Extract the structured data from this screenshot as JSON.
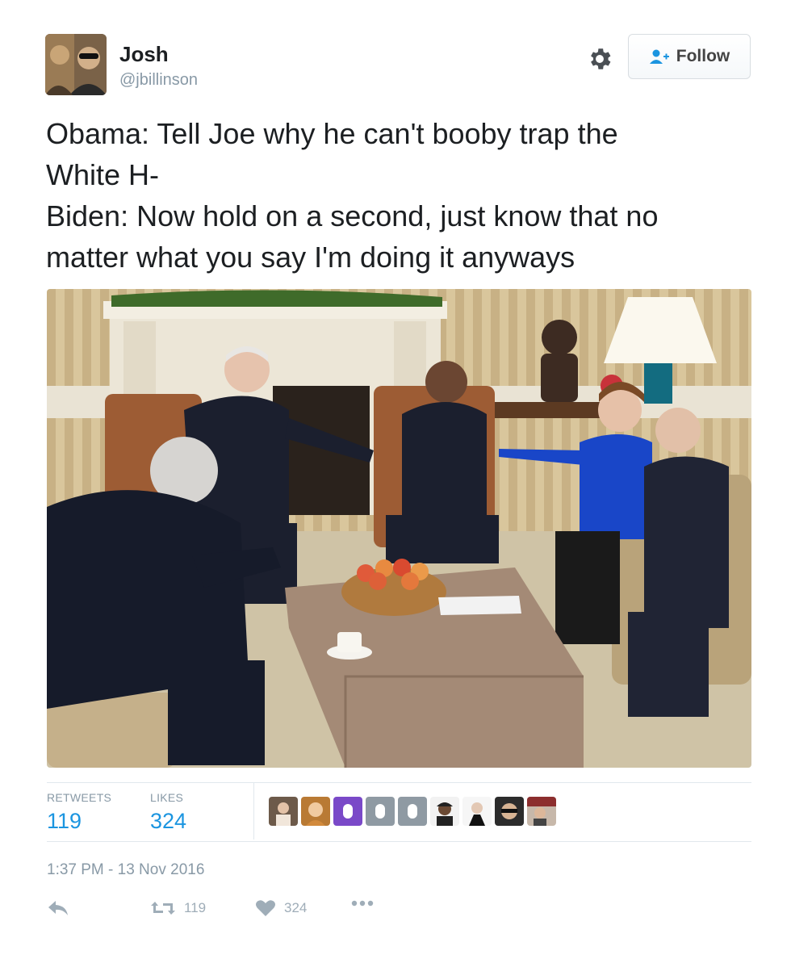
{
  "author": {
    "name": "Josh",
    "handle": "@jbillinson"
  },
  "header": {
    "settings_icon": "gear-icon",
    "follow_icon": "person-add-icon",
    "follow_label": "Follow"
  },
  "tweet": {
    "lines": [
      "Obama: Tell Joe why he can't booby trap the",
      "White H-",
      "Biden: Now hold on a second, just know that no",
      "matter what you say I'm doing it anyways"
    ]
  },
  "stats": {
    "retweets_label": "RETWEETS",
    "retweets_value": "119",
    "likes_label": "LIKES",
    "likes_value": "324"
  },
  "timestamp": "1:37 PM - 13 Nov 2016",
  "actions": {
    "reply_icon": "reply-icon",
    "retweet_icon": "retweet-icon",
    "retweet_count": "119",
    "like_icon": "heart-icon",
    "like_count": "324",
    "more_icon": "more-icon"
  },
  "colors": {
    "link_blue": "#1b95e0",
    "muted_gray": "#8899a6",
    "liker_purple": "#7a49c8",
    "liker_gray": "#8f9aa3"
  }
}
